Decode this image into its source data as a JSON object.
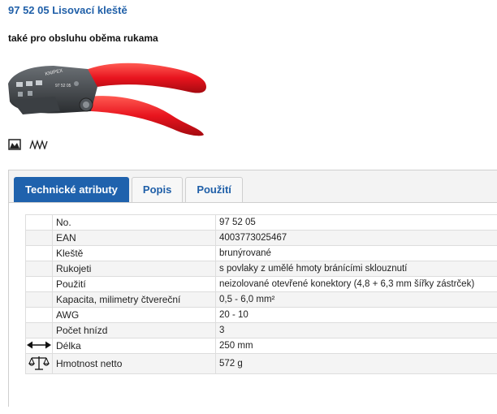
{
  "product": {
    "title": "97 52 05 Lisovací kleště",
    "subtitle": "také pro obsluhu oběma rukama",
    "image_alt": "Lisovací kleště",
    "image_brand_text": "KNIPEX",
    "image_code_text": "97 52 05"
  },
  "feature_icons": [
    "crimp-profile-icon",
    "serrated-jaws-icon"
  ],
  "tabs": [
    {
      "label": "Technické atributy",
      "active": true
    },
    {
      "label": "Popis",
      "active": false
    },
    {
      "label": "Použití",
      "active": false
    }
  ],
  "attributes": [
    {
      "name": "No.",
      "value": "97 52 05",
      "icon": ""
    },
    {
      "name": "EAN",
      "value": "4003773025467",
      "icon": ""
    },
    {
      "name": "Kleště",
      "value": "brunýrované",
      "icon": ""
    },
    {
      "name": "Rukojeti",
      "value": "s povlaky z umělé hmoty bránícími sklouznutí",
      "icon": ""
    },
    {
      "name": "Použití",
      "value": "neizolované otevřené konektory (4,8 + 6,3 mm šířky zástrček)",
      "icon": ""
    },
    {
      "name": "Kapacita, milimetry čtvereční",
      "value": "0,5 - 6,0 mm²",
      "icon": ""
    },
    {
      "name": "AWG",
      "value": "20 - 10",
      "icon": ""
    },
    {
      "name": "Počet hnízd",
      "value": "3",
      "icon": ""
    },
    {
      "name": "Délka",
      "value": "250 mm",
      "icon": "length-arrow-icon"
    },
    {
      "name": "Hmotnost netto",
      "value": "572 g",
      "icon": "scale-icon"
    }
  ],
  "colors": {
    "accent": "#1f62ad",
    "title": "#1f5fa8",
    "handle_red": "#e8141e"
  }
}
